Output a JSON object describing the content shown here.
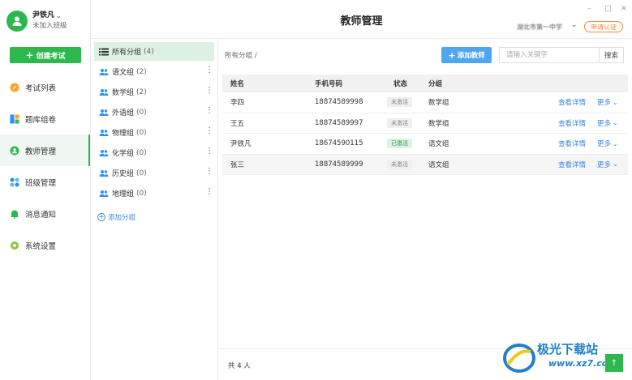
{
  "user": {
    "name": "尹铁凡",
    "status": "未加入班级"
  },
  "sidebar": {
    "create_label": "创建考试",
    "items": [
      {
        "label": "考试列表",
        "icon": "exam-list-icon"
      },
      {
        "label": "题库组卷",
        "icon": "question-bank-icon"
      },
      {
        "label": "教师管理",
        "icon": "teacher-icon",
        "active": true
      },
      {
        "label": "班级管理",
        "icon": "class-icon"
      },
      {
        "label": "消息通知",
        "icon": "bell-icon"
      },
      {
        "label": "系统设置",
        "icon": "gear-icon"
      }
    ]
  },
  "groups": {
    "items": [
      {
        "label": "所有分组",
        "count": "(4)"
      },
      {
        "label": "语文组",
        "count": "(2)"
      },
      {
        "label": "数学组",
        "count": "(2)"
      },
      {
        "label": "外语组",
        "count": "(0)"
      },
      {
        "label": "物理组",
        "count": "(0)"
      },
      {
        "label": "化学组",
        "count": "(0)"
      },
      {
        "label": "历史组",
        "count": "(0)"
      },
      {
        "label": "地理组",
        "count": "(0)"
      }
    ],
    "add_label": "添加分组"
  },
  "header": {
    "title": "教师管理",
    "school": "湖北市第一中学",
    "cert_label": "申请认证",
    "min": "–",
    "max": "□",
    "close": "✕"
  },
  "main": {
    "breadcrumb": "所有分组 /",
    "add_teacher_label": "添加教师",
    "search_placeholder": "请输入关键字",
    "search_label": "搜索",
    "columns": [
      "姓名",
      "手机号码",
      "状态",
      "分组"
    ],
    "rows": [
      {
        "name": "李四",
        "phone": "18874589998",
        "status": "未激活",
        "active": false,
        "group": "数学组"
      },
      {
        "name": "王五",
        "phone": "18874589997",
        "status": "未激活",
        "active": false,
        "group": "数学组"
      },
      {
        "name": "尹铁凡",
        "phone": "18674590115",
        "status": "已激活",
        "active": true,
        "group": "语文组"
      },
      {
        "name": "张三",
        "phone": "18874589999",
        "status": "未激活",
        "active": false,
        "group": "语文组"
      }
    ],
    "detail_label": "查看详情",
    "more_label": "更多",
    "total": "共 4 人"
  },
  "watermark": {
    "text": "极光下载站",
    "url": "www.xz7.com"
  }
}
